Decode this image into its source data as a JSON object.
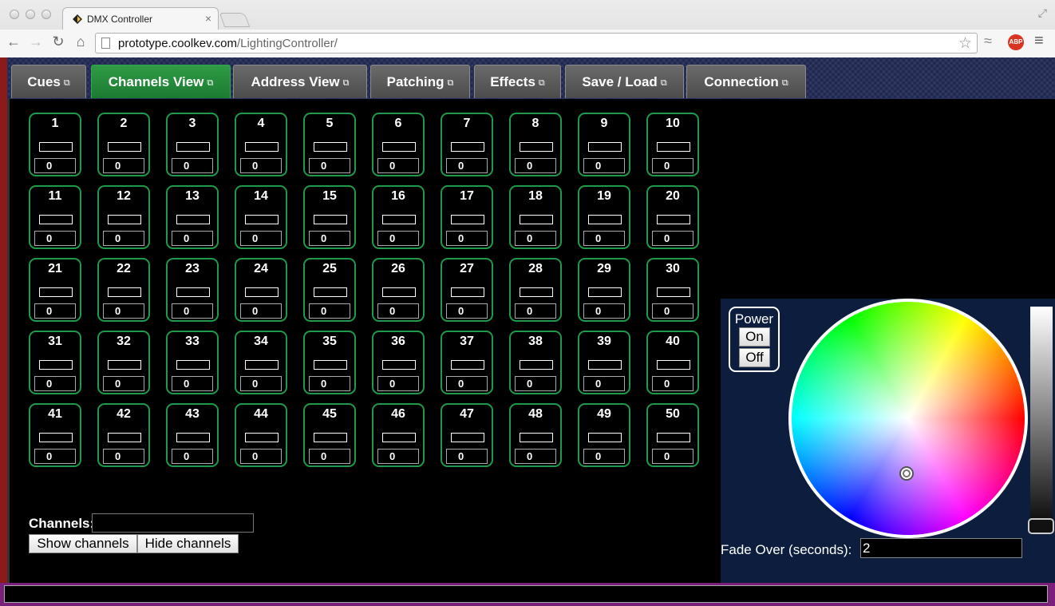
{
  "browser": {
    "tab_title": "DMX Controller",
    "url_host": "prototype.coolkev.com",
    "url_path": "/LightingController/",
    "abp_label": "ABP"
  },
  "tabs": [
    {
      "label": "Cues",
      "active": false
    },
    {
      "label": "Channels View",
      "active": true
    },
    {
      "label": "Address View",
      "active": false
    },
    {
      "label": "Patching",
      "active": false
    },
    {
      "label": "Effects",
      "active": false
    },
    {
      "label": "Save / Load",
      "active": false
    },
    {
      "label": "Connection",
      "active": false
    }
  ],
  "channels": [
    {
      "num": "1",
      "value": "0"
    },
    {
      "num": "2",
      "value": "0"
    },
    {
      "num": "3",
      "value": "0"
    },
    {
      "num": "4",
      "value": "0"
    },
    {
      "num": "5",
      "value": "0"
    },
    {
      "num": "6",
      "value": "0"
    },
    {
      "num": "7",
      "value": "0"
    },
    {
      "num": "8",
      "value": "0"
    },
    {
      "num": "9",
      "value": "0"
    },
    {
      "num": "10",
      "value": "0"
    },
    {
      "num": "11",
      "value": "0"
    },
    {
      "num": "12",
      "value": "0"
    },
    {
      "num": "13",
      "value": "0"
    },
    {
      "num": "14",
      "value": "0"
    },
    {
      "num": "15",
      "value": "0"
    },
    {
      "num": "16",
      "value": "0"
    },
    {
      "num": "17",
      "value": "0"
    },
    {
      "num": "18",
      "value": "0"
    },
    {
      "num": "19",
      "value": "0"
    },
    {
      "num": "20",
      "value": "0"
    },
    {
      "num": "21",
      "value": "0"
    },
    {
      "num": "22",
      "value": "0"
    },
    {
      "num": "23",
      "value": "0"
    },
    {
      "num": "24",
      "value": "0"
    },
    {
      "num": "25",
      "value": "0"
    },
    {
      "num": "26",
      "value": "0"
    },
    {
      "num": "27",
      "value": "0"
    },
    {
      "num": "28",
      "value": "0"
    },
    {
      "num": "29",
      "value": "0"
    },
    {
      "num": "30",
      "value": "0"
    },
    {
      "num": "31",
      "value": "0"
    },
    {
      "num": "32",
      "value": "0"
    },
    {
      "num": "33",
      "value": "0"
    },
    {
      "num": "34",
      "value": "0"
    },
    {
      "num": "35",
      "value": "0"
    },
    {
      "num": "36",
      "value": "0"
    },
    {
      "num": "37",
      "value": "0"
    },
    {
      "num": "38",
      "value": "0"
    },
    {
      "num": "39",
      "value": "0"
    },
    {
      "num": "40",
      "value": "0"
    },
    {
      "num": "41",
      "value": "0"
    },
    {
      "num": "42",
      "value": "0"
    },
    {
      "num": "43",
      "value": "0"
    },
    {
      "num": "44",
      "value": "0"
    },
    {
      "num": "45",
      "value": "0"
    },
    {
      "num": "46",
      "value": "0"
    },
    {
      "num": "47",
      "value": "0"
    },
    {
      "num": "48",
      "value": "0"
    },
    {
      "num": "49",
      "value": "0"
    },
    {
      "num": "50",
      "value": "0"
    }
  ],
  "channel_filter": {
    "label": "Channels:",
    "value": "",
    "show_label": "Show channels",
    "hide_label": "Hide channels"
  },
  "color_panel": {
    "power_label": "Power",
    "on_label": "On",
    "off_label": "Off",
    "fade_label": "Fade Over (seconds):",
    "fade_value": "2",
    "brightness_level": 0
  },
  "colors": {
    "active_tab": "#1c7a32",
    "channel_border": "#1f9a4a",
    "panel_bg": "#0c1d3e",
    "status_bar": "#7a1f7a"
  }
}
